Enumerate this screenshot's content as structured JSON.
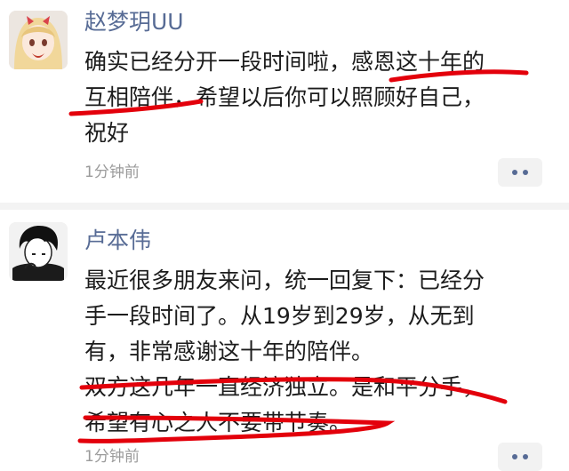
{
  "comments": [
    {
      "author": "赵梦玥UU",
      "lines": [
        "确实已经分开一段时间啦，感恩这十年的",
        "互相陪伴，希望以后你可以照顾好自己，",
        "祝好"
      ],
      "time": "1分钟前",
      "avatar_icon": "anime-girl-avatar"
    },
    {
      "author": "卢本伟",
      "lines": [
        "最近很多朋友来问，统一回复下：已经分",
        "手一段时间了。从19岁到29岁，从无到",
        "有，非常感谢这十年的陪伴。",
        "双方这几年一直经济独立。是和平分手，",
        "希望有心之人不要带节奏。"
      ],
      "time": "1分钟前",
      "avatar_icon": "anime-boy-avatar"
    }
  ],
  "more_icon": "more-options-icon",
  "colors": {
    "name": "#576b95",
    "underline": "#e3000b",
    "text": "#1c1c1c",
    "time": "#9b9b9b"
  }
}
